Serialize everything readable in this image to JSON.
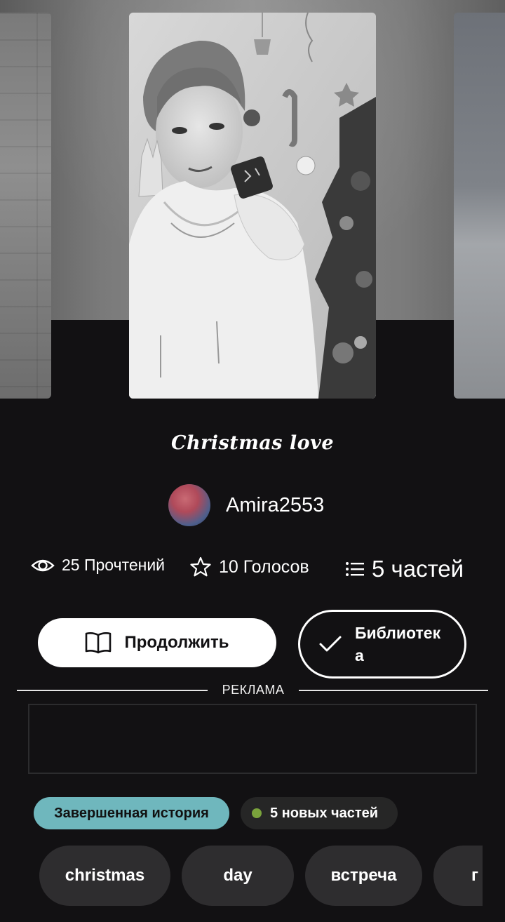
{
  "story": {
    "title": "Christmas love",
    "author": "Amira2553"
  },
  "stats": {
    "reads": "25 Прочтений",
    "votes": "10 Голосов",
    "parts": "5 частей"
  },
  "actions": {
    "continue_label": "Продолжить",
    "library_label": "Библиотека"
  },
  "ad": {
    "label": "РЕКЛАМА"
  },
  "badges": {
    "status": "Завершенная история",
    "new_parts": "5 новых частей"
  },
  "tags": [
    "christmas",
    "day",
    "встреча",
    "г"
  ],
  "colors": {
    "background": "#121113",
    "status_badge": "#6fb7bd",
    "new_dot": "#7aa33c",
    "tag_bg": "#2e2d2f"
  }
}
